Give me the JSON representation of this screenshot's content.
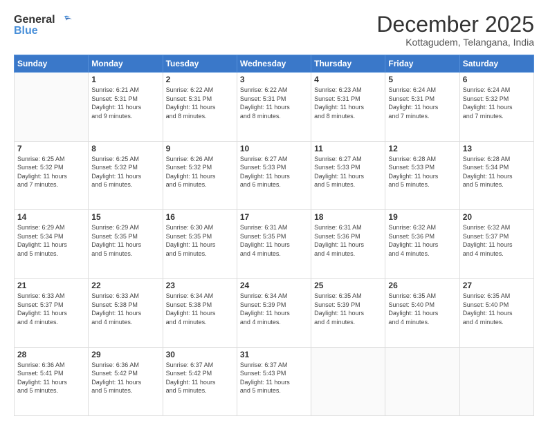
{
  "logo": {
    "general": "General",
    "blue": "Blue"
  },
  "header": {
    "month": "December 2025",
    "location": "Kottagudem, Telangana, India"
  },
  "weekdays": [
    "Sunday",
    "Monday",
    "Tuesday",
    "Wednesday",
    "Thursday",
    "Friday",
    "Saturday"
  ],
  "weeks": [
    [
      {
        "day": "",
        "sunrise": "",
        "sunset": "",
        "daylight": ""
      },
      {
        "day": "1",
        "sunrise": "6:21 AM",
        "sunset": "5:31 PM",
        "daylight": "11 hours and 9 minutes."
      },
      {
        "day": "2",
        "sunrise": "6:22 AM",
        "sunset": "5:31 PM",
        "daylight": "11 hours and 8 minutes."
      },
      {
        "day": "3",
        "sunrise": "6:22 AM",
        "sunset": "5:31 PM",
        "daylight": "11 hours and 8 minutes."
      },
      {
        "day": "4",
        "sunrise": "6:23 AM",
        "sunset": "5:31 PM",
        "daylight": "11 hours and 8 minutes."
      },
      {
        "day": "5",
        "sunrise": "6:24 AM",
        "sunset": "5:31 PM",
        "daylight": "11 hours and 7 minutes."
      },
      {
        "day": "6",
        "sunrise": "6:24 AM",
        "sunset": "5:32 PM",
        "daylight": "11 hours and 7 minutes."
      }
    ],
    [
      {
        "day": "7",
        "sunrise": "6:25 AM",
        "sunset": "5:32 PM",
        "daylight": "11 hours and 7 minutes."
      },
      {
        "day": "8",
        "sunrise": "6:25 AM",
        "sunset": "5:32 PM",
        "daylight": "11 hours and 6 minutes."
      },
      {
        "day": "9",
        "sunrise": "6:26 AM",
        "sunset": "5:32 PM",
        "daylight": "11 hours and 6 minutes."
      },
      {
        "day": "10",
        "sunrise": "6:27 AM",
        "sunset": "5:33 PM",
        "daylight": "11 hours and 6 minutes."
      },
      {
        "day": "11",
        "sunrise": "6:27 AM",
        "sunset": "5:33 PM",
        "daylight": "11 hours and 5 minutes."
      },
      {
        "day": "12",
        "sunrise": "6:28 AM",
        "sunset": "5:33 PM",
        "daylight": "11 hours and 5 minutes."
      },
      {
        "day": "13",
        "sunrise": "6:28 AM",
        "sunset": "5:34 PM",
        "daylight": "11 hours and 5 minutes."
      }
    ],
    [
      {
        "day": "14",
        "sunrise": "6:29 AM",
        "sunset": "5:34 PM",
        "daylight": "11 hours and 5 minutes."
      },
      {
        "day": "15",
        "sunrise": "6:29 AM",
        "sunset": "5:35 PM",
        "daylight": "11 hours and 5 minutes."
      },
      {
        "day": "16",
        "sunrise": "6:30 AM",
        "sunset": "5:35 PM",
        "daylight": "11 hours and 5 minutes."
      },
      {
        "day": "17",
        "sunrise": "6:31 AM",
        "sunset": "5:35 PM",
        "daylight": "11 hours and 4 minutes."
      },
      {
        "day": "18",
        "sunrise": "6:31 AM",
        "sunset": "5:36 PM",
        "daylight": "11 hours and 4 minutes."
      },
      {
        "day": "19",
        "sunrise": "6:32 AM",
        "sunset": "5:36 PM",
        "daylight": "11 hours and 4 minutes."
      },
      {
        "day": "20",
        "sunrise": "6:32 AM",
        "sunset": "5:37 PM",
        "daylight": "11 hours and 4 minutes."
      }
    ],
    [
      {
        "day": "21",
        "sunrise": "6:33 AM",
        "sunset": "5:37 PM",
        "daylight": "11 hours and 4 minutes."
      },
      {
        "day": "22",
        "sunrise": "6:33 AM",
        "sunset": "5:38 PM",
        "daylight": "11 hours and 4 minutes."
      },
      {
        "day": "23",
        "sunrise": "6:34 AM",
        "sunset": "5:38 PM",
        "daylight": "11 hours and 4 minutes."
      },
      {
        "day": "24",
        "sunrise": "6:34 AM",
        "sunset": "5:39 PM",
        "daylight": "11 hours and 4 minutes."
      },
      {
        "day": "25",
        "sunrise": "6:35 AM",
        "sunset": "5:39 PM",
        "daylight": "11 hours and 4 minutes."
      },
      {
        "day": "26",
        "sunrise": "6:35 AM",
        "sunset": "5:40 PM",
        "daylight": "11 hours and 4 minutes."
      },
      {
        "day": "27",
        "sunrise": "6:35 AM",
        "sunset": "5:40 PM",
        "daylight": "11 hours and 4 minutes."
      }
    ],
    [
      {
        "day": "28",
        "sunrise": "6:36 AM",
        "sunset": "5:41 PM",
        "daylight": "11 hours and 5 minutes."
      },
      {
        "day": "29",
        "sunrise": "6:36 AM",
        "sunset": "5:42 PM",
        "daylight": "11 hours and 5 minutes."
      },
      {
        "day": "30",
        "sunrise": "6:37 AM",
        "sunset": "5:42 PM",
        "daylight": "11 hours and 5 minutes."
      },
      {
        "day": "31",
        "sunrise": "6:37 AM",
        "sunset": "5:43 PM",
        "daylight": "11 hours and 5 minutes."
      },
      {
        "day": "",
        "sunrise": "",
        "sunset": "",
        "daylight": ""
      },
      {
        "day": "",
        "sunrise": "",
        "sunset": "",
        "daylight": ""
      },
      {
        "day": "",
        "sunrise": "",
        "sunset": "",
        "daylight": ""
      }
    ]
  ],
  "labels": {
    "sunrise": "Sunrise:",
    "sunset": "Sunset:",
    "daylight": "Daylight:"
  }
}
